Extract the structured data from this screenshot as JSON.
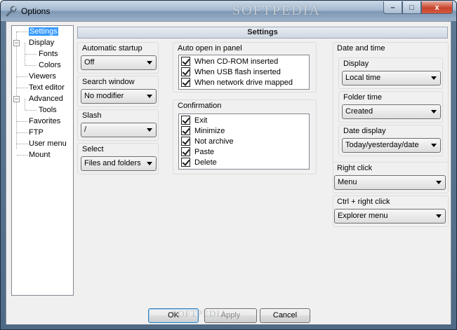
{
  "window": {
    "title": "Options",
    "watermark": "SOFTPEDIA"
  },
  "caption": {
    "minimize": "–",
    "maximize": "□",
    "close": "x"
  },
  "tree": {
    "items": [
      {
        "label": "Settings",
        "selected": true
      },
      {
        "label": "Display",
        "expander": "−"
      },
      {
        "label": "Fonts"
      },
      {
        "label": "Colors"
      },
      {
        "label": "Viewers"
      },
      {
        "label": "Text editor"
      },
      {
        "label": "Advanced",
        "expander": "−"
      },
      {
        "label": "Tools"
      },
      {
        "label": "Favorites"
      },
      {
        "label": "FTP"
      },
      {
        "label": "User menu"
      },
      {
        "label": "Mount"
      }
    ]
  },
  "header": {
    "title": "Settings"
  },
  "automatic_startup": {
    "label": "Automatic startup",
    "value": "Off"
  },
  "search_window": {
    "label": "Search window",
    "value": "No modifier"
  },
  "slash": {
    "label": "Slash",
    "value": "/"
  },
  "select": {
    "label": "Select",
    "value": "Files and folders"
  },
  "auto_open": {
    "label": "Auto open in panel",
    "items": [
      "When CD-ROM inserted",
      "When USB flash inserted",
      "When network drive mapped"
    ]
  },
  "confirmation": {
    "label": "Confirmation",
    "items": [
      "Exit",
      "Minimize",
      "Not archive",
      "Paste",
      "Delete"
    ]
  },
  "date_time": {
    "label": "Date and time",
    "display": {
      "label": "Display",
      "value": "Local time"
    },
    "folder_time": {
      "label": "Folder time",
      "value": "Created"
    },
    "date_display": {
      "label": "Date display",
      "value": "Today/yesterday/date"
    }
  },
  "right_click": {
    "label": "Right click",
    "value": "Menu"
  },
  "ctrl_right_click": {
    "label": "Ctrl + right click",
    "value": "Explorer menu"
  },
  "buttons": {
    "ok": "OK",
    "apply": "Apply",
    "cancel": "Cancel"
  },
  "bottom_watermark": "SOFTPEDIA"
}
